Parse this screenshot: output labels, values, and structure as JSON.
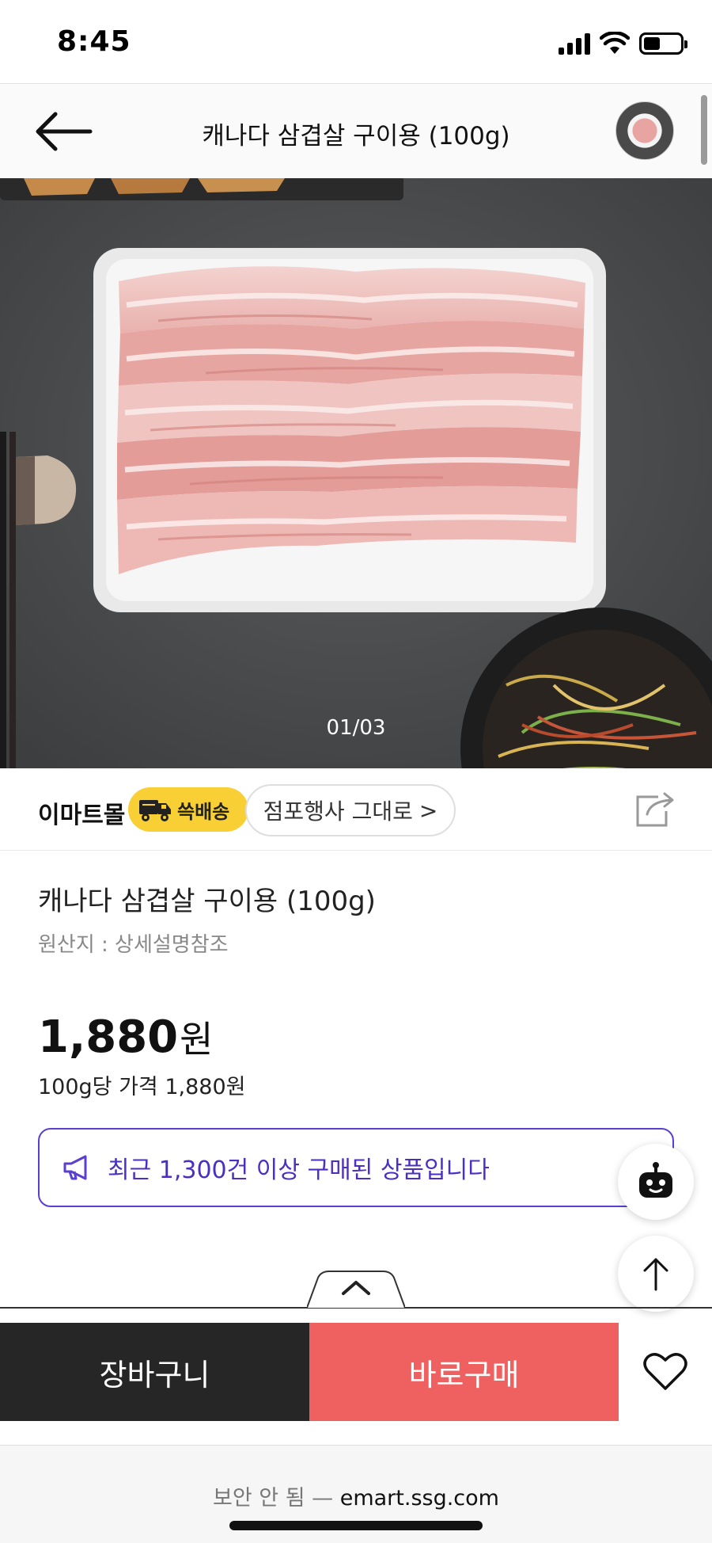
{
  "status_bar": {
    "time": "8:45",
    "battery_level": 0.45,
    "icons": [
      "signal-icon",
      "wifi-icon",
      "battery-icon"
    ]
  },
  "header": {
    "title": "캐나다 삼겹살 구이용 (100g)",
    "back_icon": "arrow-left-icon"
  },
  "gallery": {
    "counter": "01/03"
  },
  "store": {
    "name": "이마트몰",
    "delivery_label": "쓱배송",
    "event_label": "점포행사 그대로",
    "event_chevron": ">",
    "share_icon": "share-icon"
  },
  "product": {
    "title": "캐나다 삼겹살 구이용 (100g)",
    "origin": "원산지 : 상세설명참조",
    "price": "1,880",
    "currency": "원",
    "unit_price": "100g당 가격 1,880원",
    "notice": "최근 1,300건 이상 구매된 상품입니다"
  },
  "actions": {
    "cart_label": "장바구니",
    "buy_label": "바로구매",
    "wish_icon": "heart-icon"
  },
  "browser": {
    "insecure_label": "보안 안 됨 —",
    "domain": "emart.ssg.com"
  },
  "colors": {
    "accent_purple": "#5b3fd1",
    "buy_red": "#ef6060",
    "cart_dark": "#262626",
    "badge_yellow": "#f9cf36"
  }
}
